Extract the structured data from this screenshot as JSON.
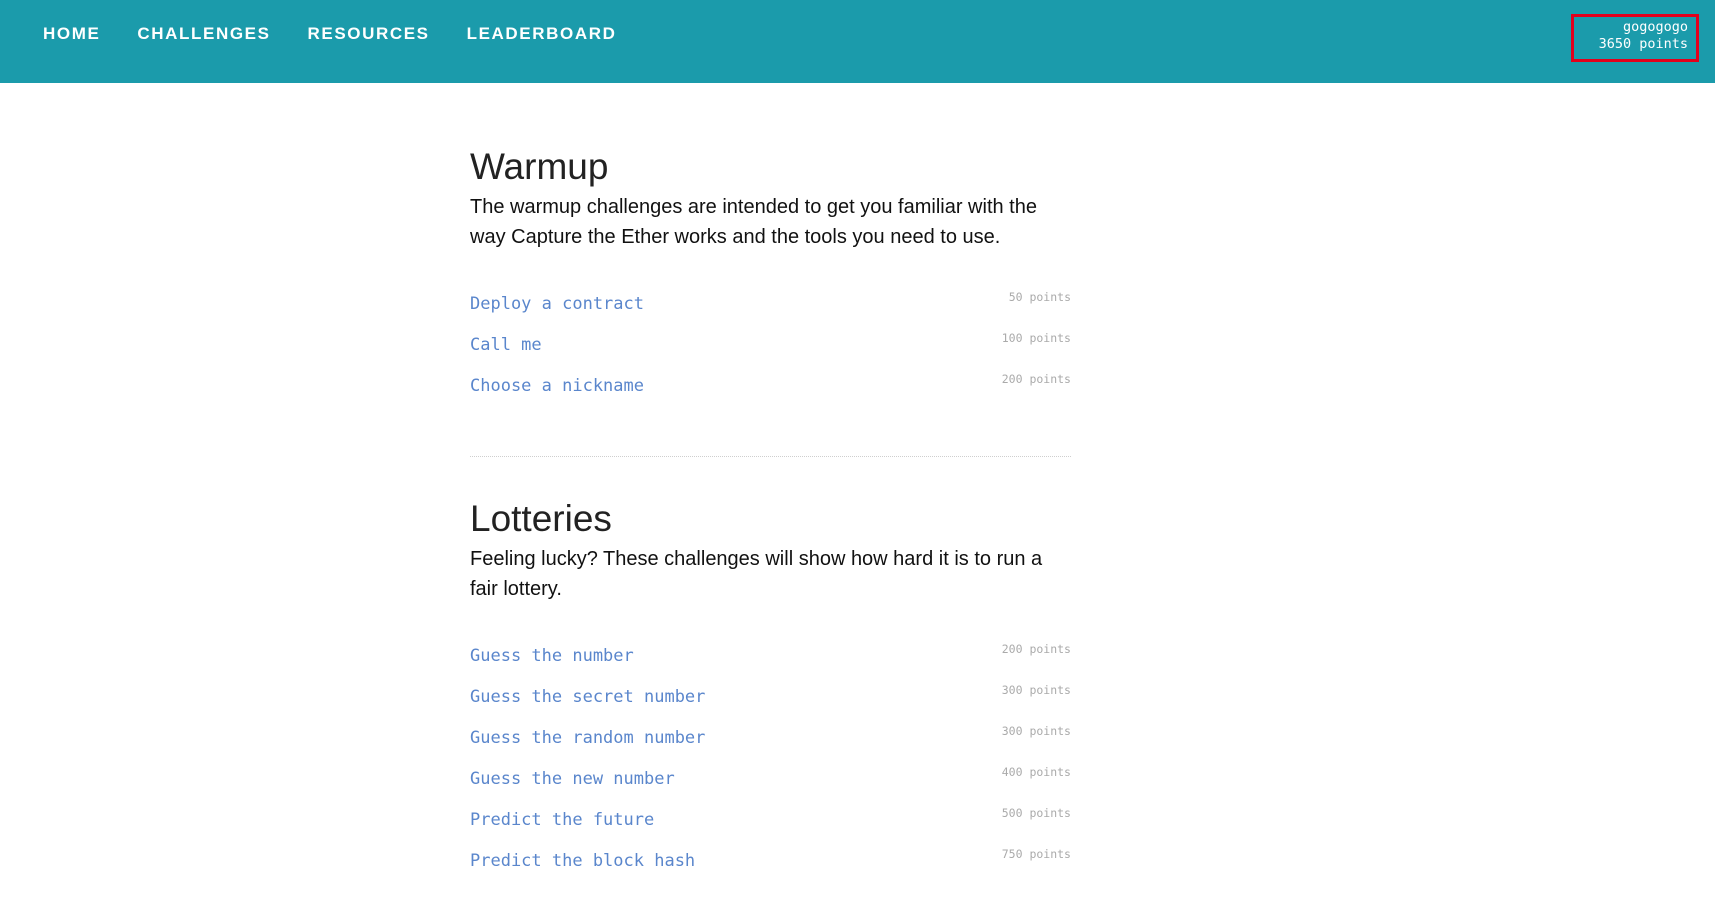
{
  "nav": {
    "items": [
      {
        "label": "HOME"
      },
      {
        "label": "CHALLENGES"
      },
      {
        "label": "RESOURCES"
      },
      {
        "label": "LEADERBOARD"
      }
    ]
  },
  "user": {
    "name": "gogogogo",
    "points": "3650 points"
  },
  "sections": [
    {
      "title": "Warmup",
      "description": "The warmup challenges are intended to get you familiar with the way Capture the Ether works and the tools you need to use.",
      "challenges": [
        {
          "name": "Deploy a contract",
          "points": "50 points"
        },
        {
          "name": "Call me",
          "points": "100 points"
        },
        {
          "name": "Choose a nickname",
          "points": "200 points"
        }
      ]
    },
    {
      "title": "Lotteries",
      "description": "Feeling lucky? These challenges will show how hard it is to run a fair lottery.",
      "challenges": [
        {
          "name": "Guess the number",
          "points": "200 points"
        },
        {
          "name": "Guess the secret number",
          "points": "300 points"
        },
        {
          "name": "Guess the random number",
          "points": "300 points"
        },
        {
          "name": "Guess the new number",
          "points": "400 points"
        },
        {
          "name": "Predict the future",
          "points": "500 points"
        },
        {
          "name": "Predict the block hash",
          "points": "750 points"
        }
      ]
    }
  ],
  "colors": {
    "topbar": "#1b9bab",
    "link": "#5a86cc",
    "highlight_border": "#e3001b"
  }
}
